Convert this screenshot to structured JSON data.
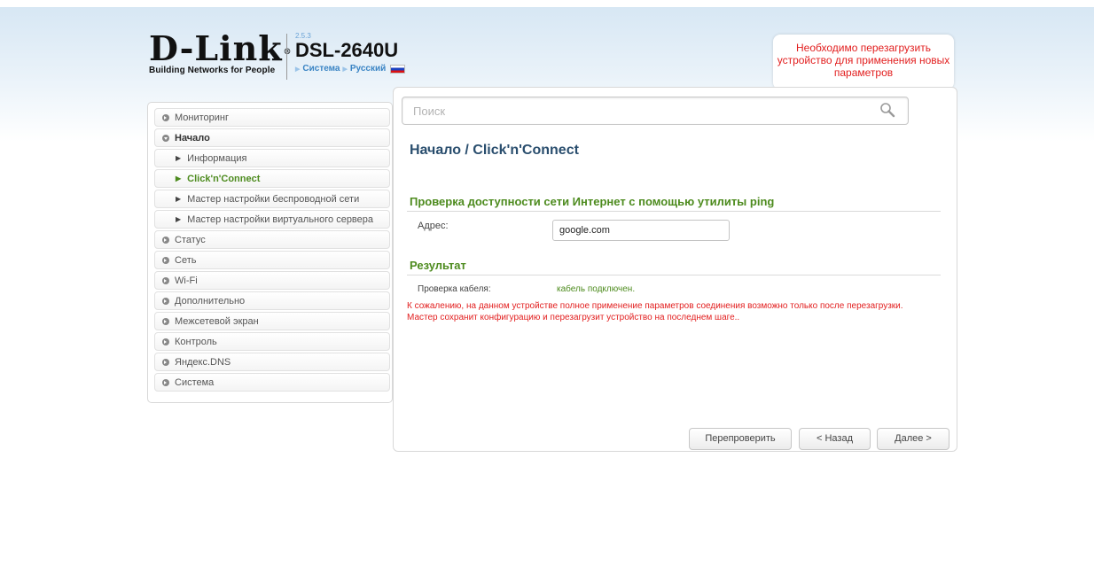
{
  "header": {
    "logo_text": "D-Link",
    "logo_reg": "®",
    "tagline": "Building Networks for People",
    "firmware_version": "2.5.3",
    "model": "DSL-2640U",
    "system_link": "Система",
    "language_link": "Русский"
  },
  "notice": {
    "text": "Необходимо перезагрузить устройство для применения новых параметров",
    "count": "1"
  },
  "search": {
    "placeholder": "Поиск"
  },
  "sidebar": {
    "items": [
      {
        "label": "Мониторинг"
      },
      {
        "label": "Начало"
      },
      {
        "label": "Информация"
      },
      {
        "label": "Click'n'Connect"
      },
      {
        "label": "Мастер настройки беспроводной сети"
      },
      {
        "label": "Мастер настройки виртуального сервера"
      },
      {
        "label": "Статус"
      },
      {
        "label": "Сеть"
      },
      {
        "label": "Wi-Fi"
      },
      {
        "label": "Дополнительно"
      },
      {
        "label": "Межсетевой экран"
      },
      {
        "label": "Контроль"
      },
      {
        "label": "Яндекс.DNS"
      },
      {
        "label": "Система"
      }
    ]
  },
  "main": {
    "title": "Начало /  Click'n'Connect",
    "ping_section_title": "Проверка доступности сети Интернет с помощью утилиты ping",
    "address_label": "Адрес:",
    "address_value": "google.com",
    "result_title": "Результат",
    "cable_label": "Проверка кабеля:",
    "cable_status": "кабель подключен.",
    "warning": "К сожалению, на данном устройстве полное применение параметров соединения возможно только после перезагрузки. Мастер сохранит конфигурацию и перезагрузит устройство на последнем шаге.."
  },
  "buttons": {
    "recheck": "Перепроверить",
    "back": "< Назад",
    "next": "Далее >"
  },
  "colors": {
    "accent_green": "#4d8b1e",
    "title_blue": "#2a4e6e",
    "alert_red": "#e21e1e",
    "link_blue": "#3a84c4"
  }
}
